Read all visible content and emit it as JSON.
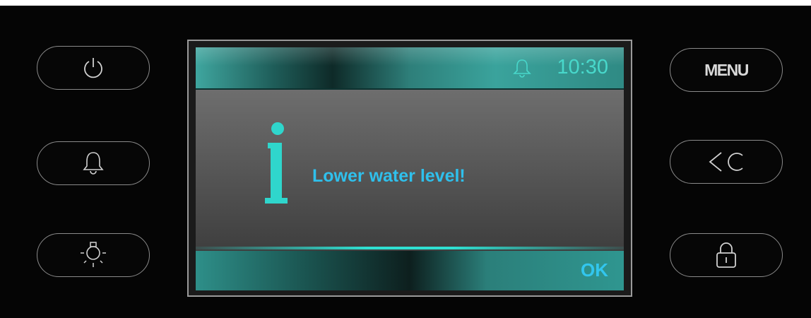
{
  "panel": {
    "buttons_left": [
      {
        "name": "power-button",
        "icon": "power-icon"
      },
      {
        "name": "alarm-button",
        "icon": "bell-icon"
      },
      {
        "name": "light-button",
        "icon": "bulb-icon"
      }
    ],
    "buttons_right": [
      {
        "name": "menu-button",
        "label": "MENU"
      },
      {
        "name": "back-clear-button",
        "label": "<C"
      },
      {
        "name": "lock-button",
        "icon": "lock-icon"
      }
    ]
  },
  "screen": {
    "header": {
      "time": "10:30",
      "alarm_icon": "bell-icon"
    },
    "message": {
      "icon": "info-icon",
      "text": "Lower water level!"
    },
    "footer": {
      "ok_label": "OK"
    }
  },
  "colors": {
    "accent_teal": "#2fc0b8",
    "message_blue": "#2fc0ec",
    "panel_black": "#050505"
  }
}
